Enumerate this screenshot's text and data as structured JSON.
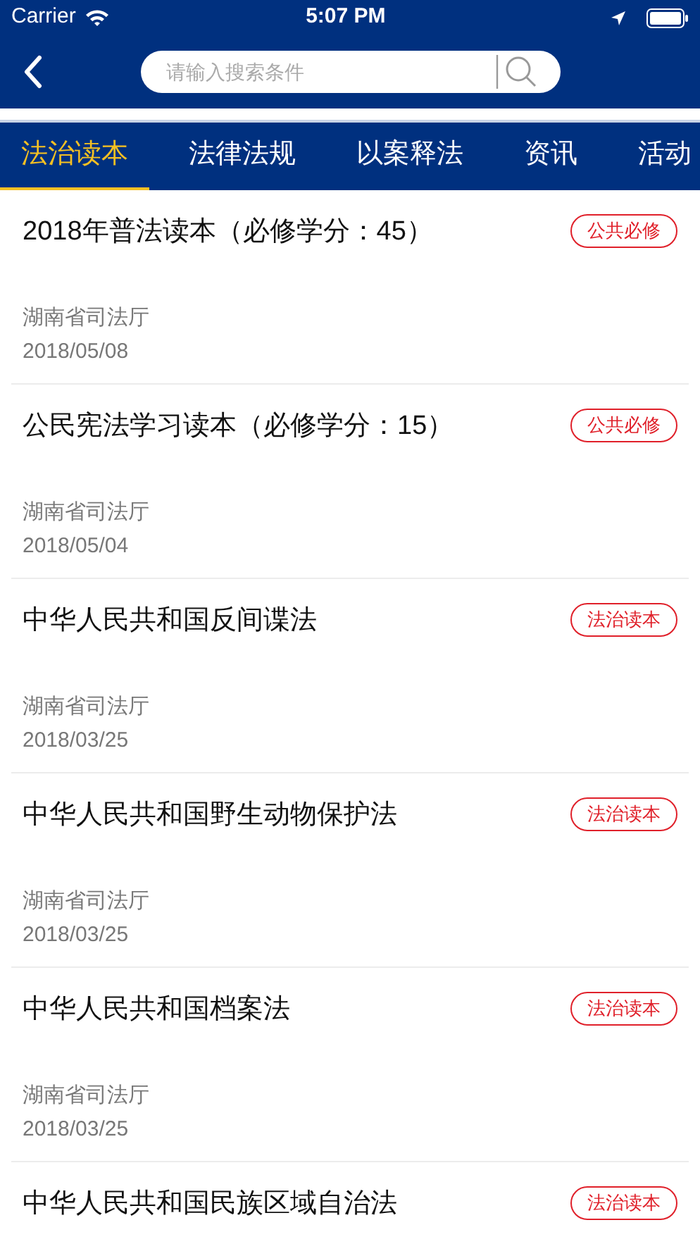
{
  "status_bar": {
    "carrier": "Carrier",
    "time": "5:07 PM"
  },
  "search": {
    "placeholder": "请输入搜索条件"
  },
  "tabs": [
    {
      "label": "法治读本",
      "selected": true
    },
    {
      "label": "法律法规",
      "selected": false
    },
    {
      "label": "以案释法",
      "selected": false
    },
    {
      "label": "资讯",
      "selected": false
    },
    {
      "label": "活动",
      "selected": false
    }
  ],
  "items": [
    {
      "title": "2018年普法读本（必修学分：45）",
      "tag": "公共必修",
      "source": "湖南省司法厅",
      "date": "2018/05/08"
    },
    {
      "title": "公民宪法学习读本（必修学分：15）",
      "tag": "公共必修",
      "source": "湖南省司法厅",
      "date": "2018/05/04"
    },
    {
      "title": "中华人民共和国反间谍法",
      "tag": "法治读本",
      "source": "湖南省司法厅",
      "date": "2018/03/25"
    },
    {
      "title": "中华人民共和国野生动物保护法",
      "tag": "法治读本",
      "source": "湖南省司法厅",
      "date": "2018/03/25"
    },
    {
      "title": "中华人民共和国档案法",
      "tag": "法治读本",
      "source": "湖南省司法厅",
      "date": "2018/03/25"
    },
    {
      "title": "中华人民共和国民族区域自治法",
      "tag": "法治读本"
    }
  ]
}
